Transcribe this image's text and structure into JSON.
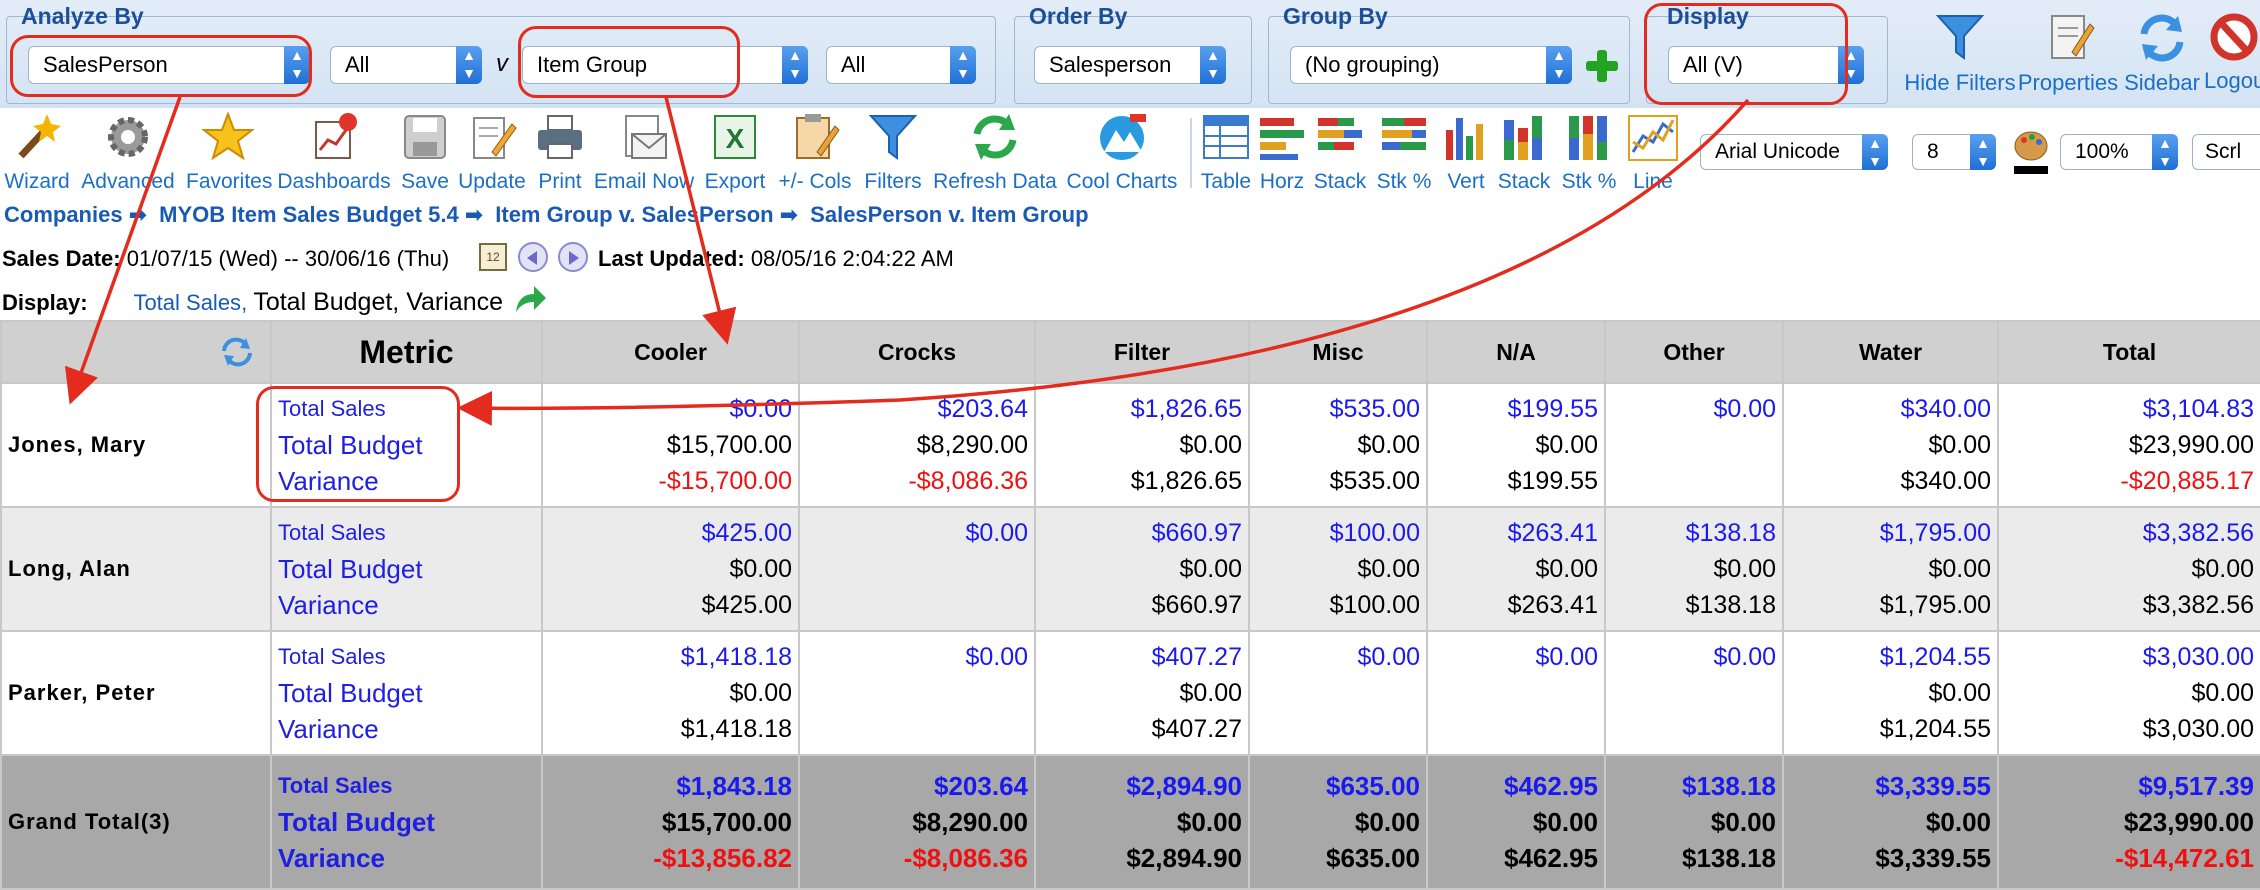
{
  "filters": {
    "analyze_by": {
      "title": "Analyze By",
      "primary": "SalesPerson",
      "primary_filter": "All",
      "connector": "v",
      "secondary": "Item Group",
      "secondary_filter": "All"
    },
    "order_by": {
      "title": "Order By",
      "value": "Salesperson"
    },
    "group_by": {
      "title": "Group By",
      "value": "(No grouping)"
    },
    "display": {
      "title": "Display",
      "value": "All (V)"
    }
  },
  "right_buttons": {
    "hide_filters": "Hide Filters",
    "properties": "Properties",
    "sidebar": "Sidebar",
    "logout": "Logou"
  },
  "toolbar": {
    "wizard": "Wizard",
    "advanced": "Advanced",
    "favorites": "Favorites",
    "dashboards": "Dashboards",
    "save": "Save",
    "update": "Update",
    "print": "Print",
    "email_now": "Email Now",
    "export": "Export",
    "cols": "+/- Cols",
    "filters": "Filters",
    "refresh": "Refresh Data",
    "cool_charts": "Cool Charts",
    "table": "Table",
    "horz": "Horz",
    "stack": "Stack",
    "stk_pct": "Stk %",
    "vert": "Vert",
    "stack2": "Stack",
    "stk_pct2": "Stk %",
    "line": "Line",
    "font": "Arial Unicode",
    "font_size": "8",
    "zoom": "100%",
    "scroll": "Scrl"
  },
  "breadcrumb": [
    "Companies",
    "MYOB Item Sales Budget 5.4",
    "Item Group v. SalesPerson",
    "SalesPerson v. Item Group"
  ],
  "info": {
    "sales_date_label": "Sales Date:",
    "sales_date_value": "01/07/15 (Wed) -- 30/06/16 (Thu)",
    "updated_label": "Last Updated:",
    "updated_value": "08/05/16 2:04:22 AM",
    "display_label": "Display:",
    "display_link": "Total Sales",
    "display_rest": "Total Budget, Variance"
  },
  "table": {
    "headers": [
      "Metric",
      "Cooler",
      "Crocks",
      "Filter",
      "Misc",
      "N/A",
      "Other",
      "Water",
      "Total"
    ],
    "metrics": [
      "Total Sales",
      "Total Budget",
      "Variance"
    ],
    "rows": [
      {
        "name": "Jones, Mary",
        "sales": [
          "$0.00",
          "$203.64",
          "$1,826.65",
          "$535.00",
          "$199.55",
          "$0.00",
          "$340.00",
          "$3,104.83"
        ],
        "budget": [
          "$15,700.00",
          "$8,290.00",
          "$0.00",
          "$0.00",
          "$0.00",
          "",
          "$0.00",
          "$23,990.00"
        ],
        "variance": [
          "-$15,700.00",
          "-$8,086.36",
          "$1,826.65",
          "$535.00",
          "$199.55",
          "",
          "$340.00",
          "-$20,885.17"
        ]
      },
      {
        "name": "Long, Alan",
        "sales": [
          "$425.00",
          "$0.00",
          "$660.97",
          "$100.00",
          "$263.41",
          "$138.18",
          "$1,795.00",
          "$3,382.56"
        ],
        "budget": [
          "$0.00",
          "",
          "$0.00",
          "$0.00",
          "$0.00",
          "$0.00",
          "$0.00",
          "$0.00"
        ],
        "variance": [
          "$425.00",
          "",
          "$660.97",
          "$100.00",
          "$263.41",
          "$138.18",
          "$1,795.00",
          "$3,382.56"
        ]
      },
      {
        "name": "Parker, Peter",
        "sales": [
          "$1,418.18",
          "$0.00",
          "$407.27",
          "$0.00",
          "$0.00",
          "$0.00",
          "$1,204.55",
          "$3,030.00"
        ],
        "budget": [
          "$0.00",
          "",
          "$0.00",
          "",
          "",
          "",
          "$0.00",
          "$0.00"
        ],
        "variance": [
          "$1,418.18",
          "",
          "$407.27",
          "",
          "",
          "",
          "$1,204.55",
          "$3,030.00"
        ]
      }
    ],
    "grand": {
      "name": "Grand Total(3)",
      "sales": [
        "$1,843.18",
        "$203.64",
        "$2,894.90",
        "$635.00",
        "$462.95",
        "$138.18",
        "$3,339.55",
        "$9,517.39"
      ],
      "budget": [
        "$15,700.00",
        "$8,290.00",
        "$0.00",
        "$0.00",
        "$0.00",
        "$0.00",
        "$0.00",
        "$23,990.00"
      ],
      "variance": [
        "-$13,856.82",
        "-$8,086.36",
        "$2,894.90",
        "$635.00",
        "$462.95",
        "$138.18",
        "$3,339.55",
        "-$14,472.61"
      ]
    }
  },
  "colors": {
    "link_blue": "#1a5ab2",
    "value_blue": "#1a1aee",
    "negative_red": "#ee1111",
    "annotation_red": "#e32b1e"
  }
}
